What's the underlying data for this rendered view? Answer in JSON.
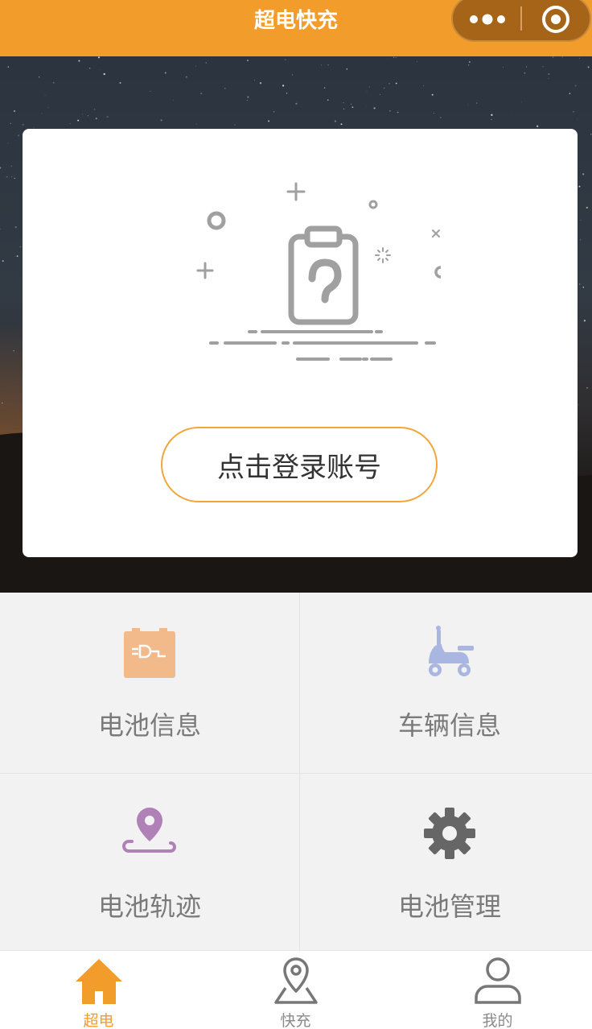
{
  "header": {
    "title": "超电快充",
    "bar_color": "#f29c2b"
  },
  "capsule": {
    "more_icon": "more-dots-icon",
    "close_icon": "target-icon"
  },
  "login_card": {
    "illustration": "clipboard-question-icon",
    "button_label": "点击登录账号",
    "button_border_color": "#f0a63a"
  },
  "grid": {
    "items": [
      {
        "label": "电池信息",
        "icon": "battery-icon",
        "color": "#f2b98a"
      },
      {
        "label": "车辆信息",
        "icon": "scooter-icon",
        "color": "#a9b6e2"
      },
      {
        "label": "电池轨迹",
        "icon": "location-track-icon",
        "color": "#b081b7"
      },
      {
        "label": "电池管理",
        "icon": "gear-icon",
        "color": "#666666"
      }
    ]
  },
  "tabbar": {
    "active_color": "#f29c2b",
    "tabs": [
      {
        "label": "超电",
        "icon": "home-icon",
        "active": true
      },
      {
        "label": "快充",
        "icon": "map-pin-icon",
        "active": false
      },
      {
        "label": "我的",
        "icon": "user-icon",
        "active": false
      }
    ]
  }
}
